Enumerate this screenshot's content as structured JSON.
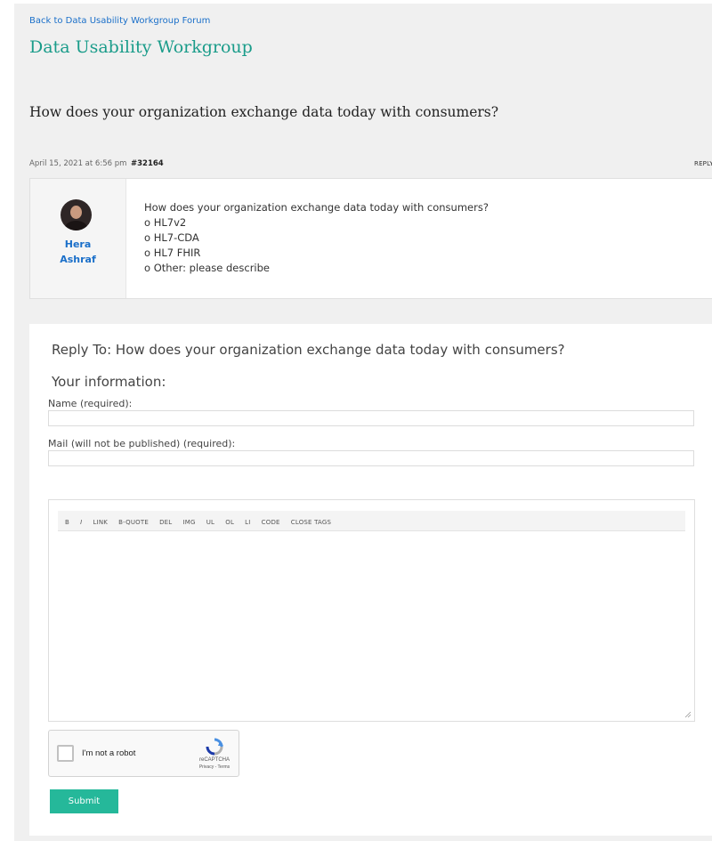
{
  "nav": {
    "back_link": "Back to Data Usability Workgroup Forum"
  },
  "forum": {
    "title": "Data Usability Workgroup"
  },
  "topic": {
    "title": "How does your organization exchange data today with consumers?"
  },
  "post": {
    "date": "April 15, 2021 at 6:56 pm",
    "id": "#32164",
    "reply_label": "REPLY",
    "author": {
      "first": "Hera",
      "last": "Ashraf"
    },
    "content": [
      "How does your organization exchange data today with consumers?",
      "o HL7v2",
      "o HL7-CDA",
      "o HL7 FHIR",
      "o Other: please describe"
    ]
  },
  "reply_form": {
    "heading": "Reply To: How does your organization exchange data today with consumers?",
    "info_heading": "Your information:",
    "name_label": "Name (required):",
    "name_value": "",
    "mail_label": "Mail (will not be published) (required):",
    "mail_value": "",
    "toolbar": [
      "B",
      "I",
      "LINK",
      "B-QUOTE",
      "DEL",
      "IMG",
      "UL",
      "OL",
      "LI",
      "CODE",
      "CLOSE TAGS"
    ],
    "message_value": "",
    "captcha": {
      "label": "I'm not a robot",
      "brand": "reCAPTCHA",
      "terms": "Privacy - Terms"
    },
    "submit_label": "Submit"
  },
  "colors": {
    "accent": "#25b89a",
    "link": "#1a6fc9",
    "forum_title": "#1a9c8a"
  }
}
